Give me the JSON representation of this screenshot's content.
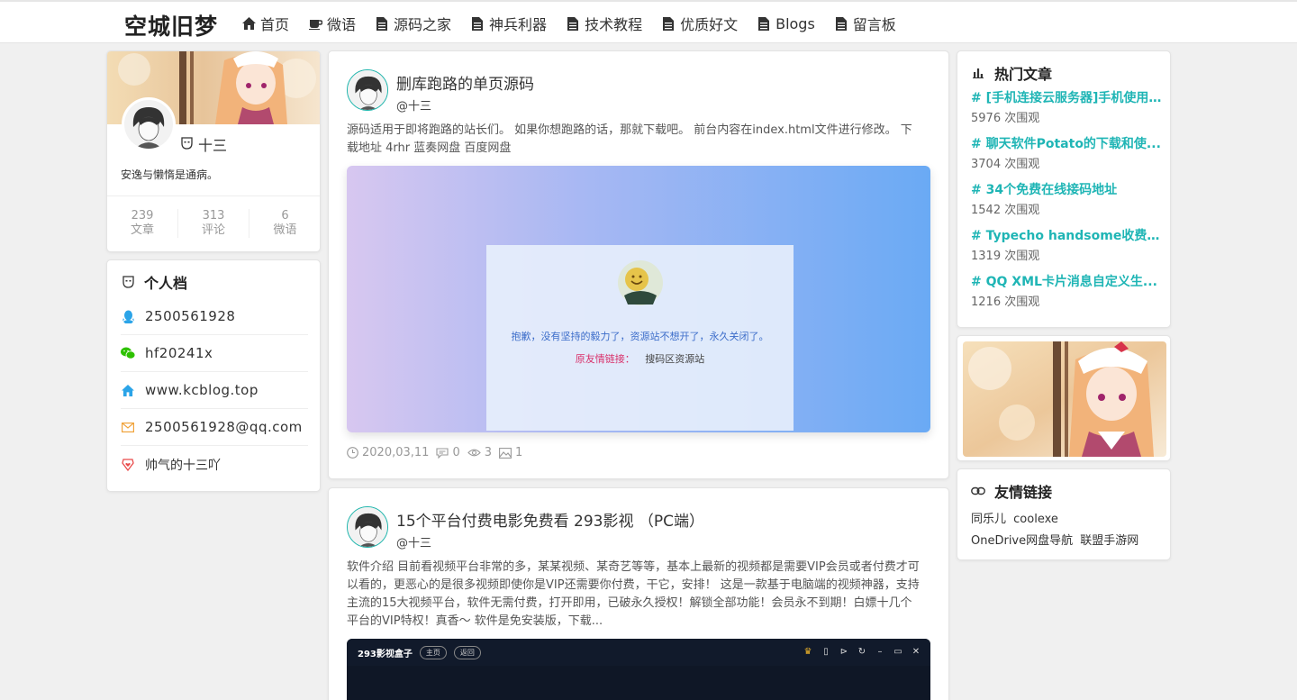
{
  "header": {
    "brand": "空城旧梦",
    "nav": [
      {
        "label": "首页",
        "icon": "home-icon"
      },
      {
        "label": "微语",
        "icon": "coffee-icon"
      },
      {
        "label": "源码之家",
        "icon": "file-icon"
      },
      {
        "label": "神兵利器",
        "icon": "file-icon"
      },
      {
        "label": "技术教程",
        "icon": "file-icon"
      },
      {
        "label": "优质好文",
        "icon": "file-icon"
      },
      {
        "label": "Blogs",
        "icon": "file-icon"
      },
      {
        "label": "留言板",
        "icon": "file-icon"
      }
    ]
  },
  "profile": {
    "name": "十三",
    "bio": "安逸与懒惰是通病。",
    "stats": [
      {
        "value": "239",
        "label": "文章"
      },
      {
        "value": "313",
        "label": "评论"
      },
      {
        "value": "6",
        "label": "微语"
      }
    ]
  },
  "personal": {
    "title": "个人档",
    "items": [
      {
        "icon": "qq-icon",
        "text": "2500561928",
        "color": "#2ba4e8"
      },
      {
        "icon": "wechat-icon",
        "text": "hf20241x",
        "color": "#2dc100"
      },
      {
        "icon": "home-icon",
        "text": "www.kcblog.top",
        "color": "#2ba4e8"
      },
      {
        "icon": "mail-icon",
        "text": "2500561928@qq.com",
        "color": "#f0a33b"
      },
      {
        "icon": "heart-badge-icon",
        "text": "帅气的十三吖",
        "color": "#e94b4b"
      }
    ]
  },
  "posts": [
    {
      "title": "删库跑路的单页源码",
      "author": "@十三",
      "excerpt": "源码适用于即将跑路的站长们。 如果你想跑路的话，那就下载吧。 前台内容在index.html文件进行修改。 下载地址   4rhr 蓝奏网盘 百度网盘",
      "image_notice": "抱歉，没有坚持的毅力了，资源站不想开了，永久关闭了。",
      "image_link_label": "原友情链接：",
      "image_link_text": "搜码区资源站",
      "date": "2020,03,11",
      "comments": "0",
      "views": "3",
      "likes": "1"
    },
    {
      "title": "15个平台付费电影免费看 293影视 （PC端）",
      "author": "@十三",
      "excerpt": "软件介绍 目前看视频平台非常的多，某某视频、某奇艺等等，基本上最新的视频都是需要VIP会员或者付费才可以看的，更恶心的是很多视频即使你是VIP还需要你付费，干它，安排！ 这是一款基于电脑端的视频神器，支持主流的15大视频平台，软件无需付费，打开即用，已破永久授权！解锁全部功能！会员永不到期！白嫖十几个平台的VIP特权！真香～ 软件是免安装版，下载...",
      "app_name": "293影视盒子",
      "app_buttons": [
        "主页",
        "返回"
      ]
    }
  ],
  "hot": {
    "title": "热门文章",
    "items": [
      {
        "title": "# [手机连接云服务器]手机使用...",
        "views": "5976 次围观"
      },
      {
        "title": "# 聊天软件Potato的下载和使...",
        "views": "3704 次围观"
      },
      {
        "title": "# 34个免费在线接码地址",
        "views": "1542 次围观"
      },
      {
        "title": "# Typecho handsome收费主题",
        "views": "1319 次围观"
      },
      {
        "title": "# QQ XML卡片消息自定义生...",
        "views": "1216 次围观"
      }
    ]
  },
  "links": {
    "title": "友情链接",
    "row1": [
      "同乐儿",
      "coolexe"
    ],
    "row2": [
      "OneDrive网盘导航",
      "联盟手游网"
    ]
  },
  "colors": {
    "accent": "#1fb5b5",
    "background": "#f0f0f0"
  }
}
